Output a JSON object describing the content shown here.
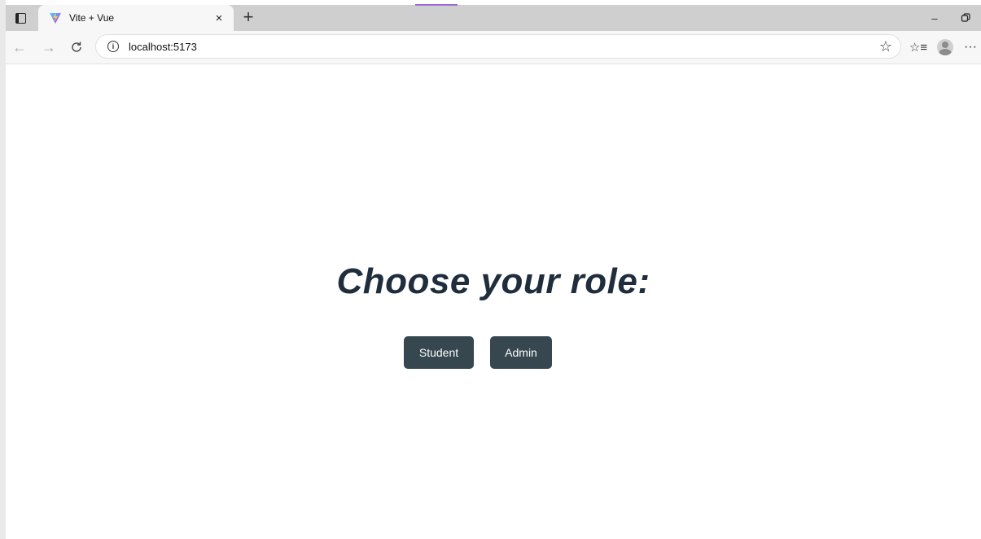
{
  "browser": {
    "tab": {
      "title": "Vite + Vue",
      "favicon": "vite-logo-icon",
      "close_glyph": "×"
    },
    "new_tab_glyph": "+",
    "window_controls": {
      "minimize_glyph": "–",
      "restore_glyph": "▢"
    },
    "nav": {
      "back_glyph": "←",
      "forward_glyph": "→",
      "reload_glyph": "C"
    },
    "address_bar": {
      "url": "localhost:5173",
      "info_glyph": "i",
      "star_glyph": "☆"
    },
    "favorites_glyph": "☆≡",
    "more_glyph": "···"
  },
  "page": {
    "heading": "Choose your role:",
    "buttons": {
      "student_label": "Student",
      "admin_label": "Admin"
    }
  },
  "colors": {
    "heading": "#1f2d3d",
    "button_bg": "#36474f",
    "button_text": "#ffffff",
    "accent_line": "#9b6bd6"
  }
}
